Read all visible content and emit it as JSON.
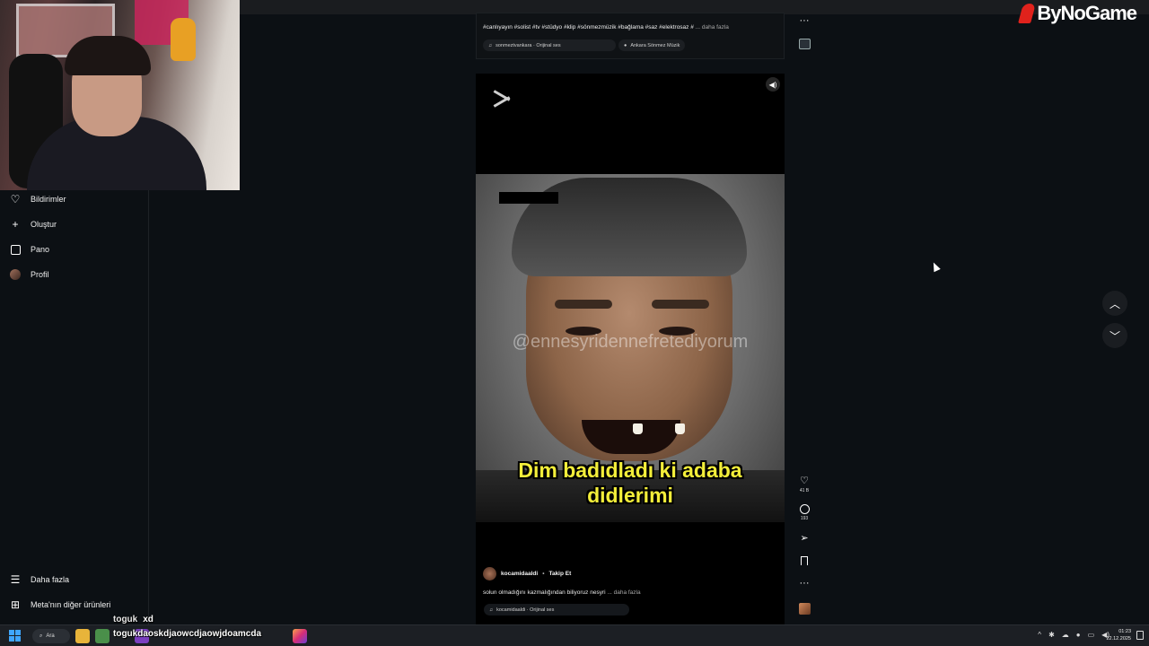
{
  "brand": {
    "name": "ByNoGame"
  },
  "sidebar": {
    "items": [
      {
        "label": "Bildirimler",
        "icon": "heart-icon"
      },
      {
        "label": "Oluştur",
        "icon": "plus-icon"
      },
      {
        "label": "Pano",
        "icon": "dashboard-icon"
      },
      {
        "label": "Profil",
        "icon": "avatar-icon"
      }
    ],
    "bottom_items": [
      {
        "label": "Daha fazla",
        "icon": "menu-icon"
      },
      {
        "label": "Meta'nın diğer ürünleri",
        "icon": "meta-apps-icon"
      }
    ]
  },
  "previous_post": {
    "hashtags": "#canlıyayın #solist #tv #stüdyo #klip #sönmezmüzik #bağlama #saz #elektrosaz #",
    "more_label": "... daha fazla",
    "audio": "sonmeztvankara · Orijinal ses",
    "location": "Ankara Sönmez Müzik"
  },
  "reel": {
    "watermark": "@ennesyridennefretediyorum",
    "caption_line1": "Dim badıdladı ki adaba",
    "caption_line2": "didlerimi",
    "author": "kocamidaaldi",
    "separator": "•",
    "follow_label": "Takip Et",
    "description": "solun olmadığını kazmalığından biliyoruz nesyri",
    "more_label": "... daha fazla",
    "audio": "kocamidaaldi · Orijinal ses"
  },
  "actions": {
    "likes": "41 B",
    "comments": "193"
  },
  "chat": {
    "line1_user": "toguk",
    "line1_msg": "xd",
    "line2_user": "toguk",
    "line2_msg": "daoskdjaowcdjaowjdoamcda"
  },
  "taskbar": {
    "search_label": "Ara",
    "time": "01:23",
    "date": "22.12.2025"
  },
  "colors": {
    "background": "#0c1014",
    "caption_yellow": "#f3ee3a",
    "brand_red": "#e0221c",
    "windows_blue": "#3fa6ff"
  }
}
